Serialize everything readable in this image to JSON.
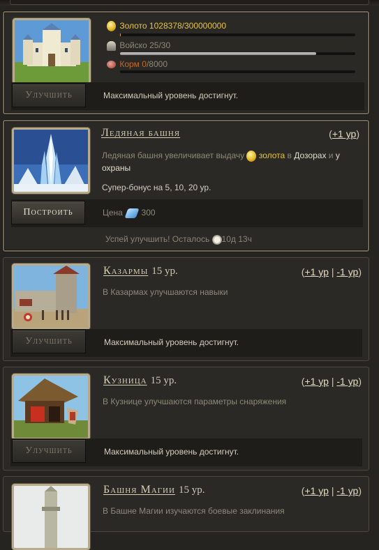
{
  "castle": {
    "gold_text": "Золото 1028378/300000000",
    "gold_fill": 0.0034,
    "army_text": "Войско 25/30",
    "army_fill": 0.833,
    "food_label": "Корм",
    "food_value": "0",
    "food_max": "/8000",
    "food_fill": 0,
    "button_label": "Улучшить",
    "message": "Максимальный уровень достигнут."
  },
  "ice_tower": {
    "title": "Ледяная башня",
    "level_link_open": "(",
    "level_link": "+1 ур",
    "level_link_close": ")",
    "desc_part1": "Ледяная башня увеличивает выдачу",
    "desc_gold": "золота",
    "desc_part2": "в",
    "desc_patrols": "Дозорах",
    "desc_part3": "и",
    "desc_guard": "у охраны",
    "super_bonus": "Супер-бонус на 5, 10, 20 ур.",
    "button_label": "Построить",
    "price_label": "Цена",
    "price_value": "300",
    "timer_text": "Успей улучшить! Осталось",
    "timer_value": "10д 13ч"
  },
  "buildings": [
    {
      "title": "Казармы",
      "level": "15 ур.",
      "plus_link": "+1 ур",
      "minus_link": "-1 ур",
      "description": "В Казармах улучшаются навыки",
      "button_label": "Улучшить",
      "message": "Максимальный уровень достигнут."
    },
    {
      "title": "Кузница",
      "level": "15 ур.",
      "plus_link": "+1 ур",
      "minus_link": "-1 ур",
      "description": "В Кузнице улучшаются параметры снаряжения",
      "button_label": "Улучшить",
      "message": "Максимальный уровень достигнут."
    },
    {
      "title": "Башня Магии",
      "level": "15 ур.",
      "plus_link": "+1 ур",
      "minus_link": "-1 ур",
      "description": "В Башне Магии изучаются боевые заклинания"
    }
  ],
  "link_sep": "|",
  "paren_open": "(",
  "paren_close": ")",
  "colors": {
    "gold": "#e8c53b",
    "food": "#c06b2a",
    "background": "#262420"
  }
}
